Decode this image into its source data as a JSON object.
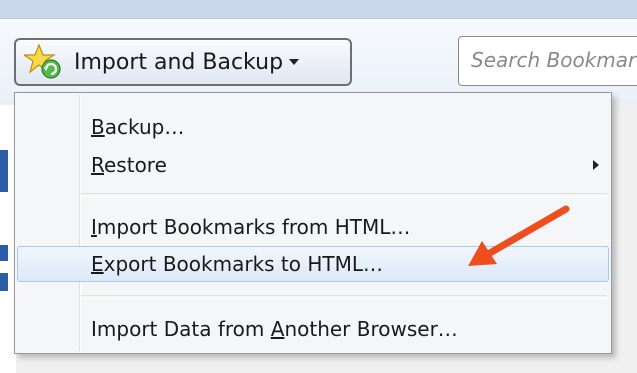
{
  "toolbar": {
    "import_button": {
      "label": "Import and Backup",
      "icon": "star-refresh-icon"
    },
    "search": {
      "placeholder": "Search Bookmarks"
    }
  },
  "menu": {
    "items": [
      {
        "label": "Backup…",
        "mnemonic": "B",
        "has_submenu": false,
        "highlighted": false
      },
      {
        "label": "Restore",
        "mnemonic": "R",
        "has_submenu": true,
        "highlighted": false
      },
      {
        "label": "Import Bookmarks from HTML…",
        "mnemonic": "I",
        "has_submenu": false,
        "highlighted": false
      },
      {
        "label": "Export Bookmarks to HTML…",
        "mnemonic": "E",
        "has_submenu": false,
        "highlighted": true
      },
      {
        "label": "Import Data from Another Browser…",
        "mnemonic": "A",
        "has_submenu": false,
        "highlighted": false
      }
    ]
  },
  "annotation": {
    "arrow_color": "#ee4e1e",
    "points_to": "Export Bookmarks to HTML…"
  },
  "colors": {
    "highlight_border": "#a8c8ee",
    "menu_background": "#f5f6f7",
    "toolbar_background": "#e9f0f8"
  }
}
